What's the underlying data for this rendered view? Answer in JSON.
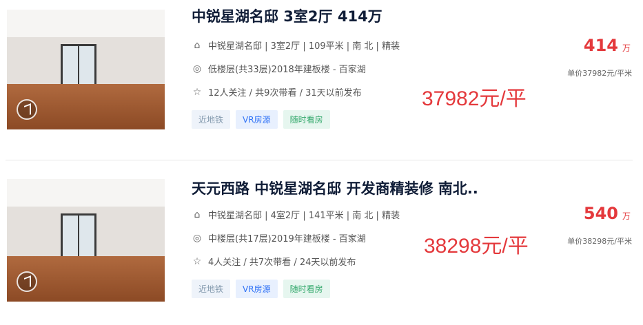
{
  "listings": [
    {
      "title": "中锐星湖名邸 3室2厅 414万",
      "house_info": "中锐星湖名邸 | 3室2厅 | 109平米 | 南 北 | 精装",
      "position_info": "低楼层(共33层)2018年建板楼 - 百家湖",
      "follow_info": "12人关注 / 共9次带看 / 31天以前发布",
      "tags": [
        "近地铁",
        "VR房源",
        "随时看房"
      ],
      "total_price": "414",
      "total_unit": "万",
      "unit_price_small": "单价37982元/平米",
      "unit_price_big": "37982元/平"
    },
    {
      "title": "天元西路 中锐星湖名邸 开发商精装修 南北..",
      "house_info": "中锐星湖名邸 | 4室2厅 | 141平米 | 南 北 | 精装",
      "position_info": "中楼层(共17层)2019年建板楼 - 百家湖",
      "follow_info": "4人关注 / 共7次带看 / 24天以前发布",
      "tags": [
        "近地铁",
        "VR房源",
        "随时看房"
      ],
      "total_price": "540",
      "total_unit": "万",
      "unit_price_small": "单价38298元/平米",
      "unit_price_big": "38298元/平"
    }
  ],
  "icons": {
    "house": "house-icon",
    "location": "location-pin-icon",
    "follow": "star-icon",
    "vr": "vr-badge-icon"
  },
  "colors": {
    "price_red": "#e4393c",
    "title": "#101d37",
    "tag_subway": "#849aae",
    "tag_vr": "#3072f6",
    "tag_visit": "#33a86b"
  }
}
